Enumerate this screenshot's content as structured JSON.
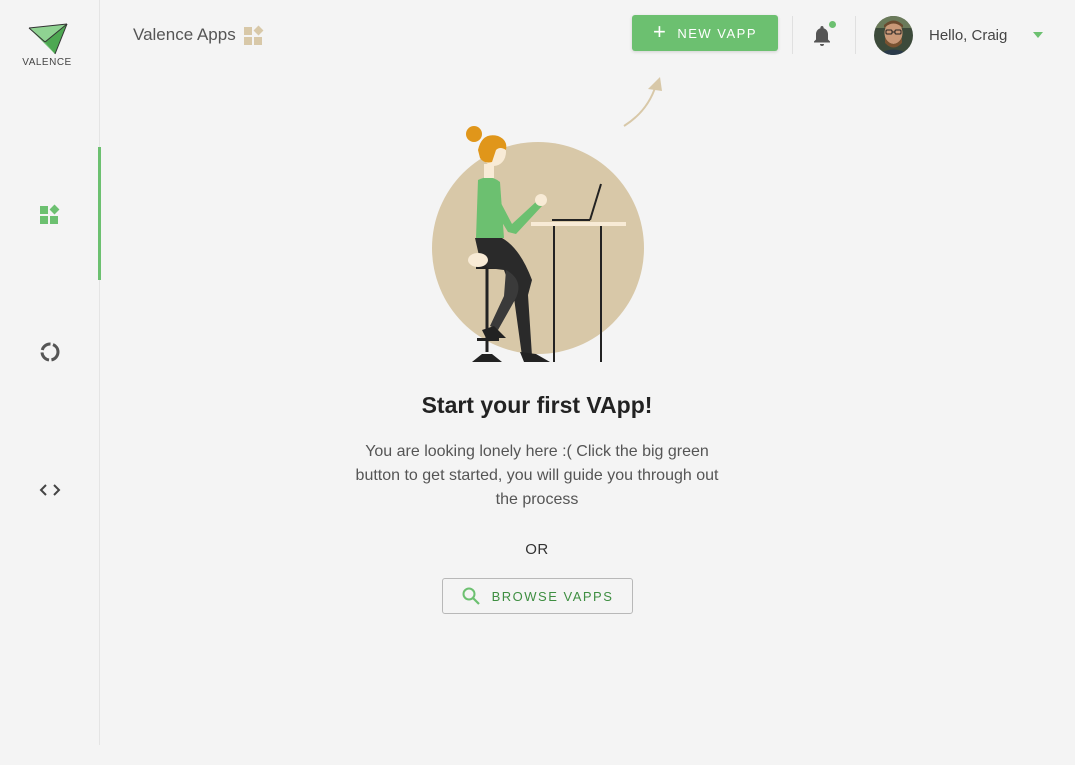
{
  "brand": {
    "name": "VALENCE"
  },
  "header": {
    "title": "Valence Apps",
    "new_button_label": "NEW VAPP",
    "greeting": "Hello, Craig"
  },
  "sidebar": {
    "items": [
      {
        "icon": "apps-icon",
        "active": true
      },
      {
        "icon": "activity-icon",
        "active": false
      },
      {
        "icon": "code-icon",
        "active": false
      }
    ]
  },
  "main": {
    "title": "Start your first VApp!",
    "description": "You are looking lonely here :( Click the big green button to get started, you will guide you through out the process",
    "or_label": "OR",
    "browse_button_label": "BROWSE VAPPS"
  },
  "colors": {
    "accent": "#6cc070",
    "accent_dark": "#3e8e41",
    "illustration_circle": "#d8c8a8"
  }
}
